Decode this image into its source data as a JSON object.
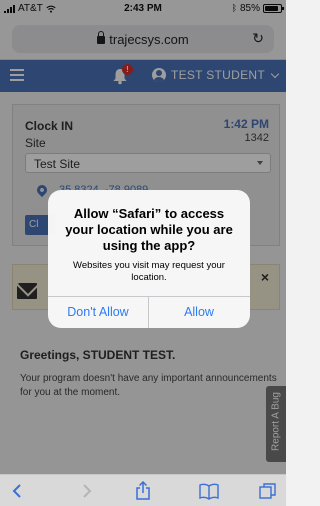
{
  "status_bar": {
    "carrier": "AT&T",
    "time": "2:43 PM",
    "battery": "85%",
    "battery_level": 0.85
  },
  "browser": {
    "url": "trajecsys.com"
  },
  "header": {
    "notification_count": "!",
    "user_name": "TEST STUDENT"
  },
  "clock_card": {
    "title": "Clock IN",
    "time": "1:42 PM",
    "sub_value": "1342",
    "site_label": "Site",
    "site_value": "Test Site",
    "coordinates": "35.8324, -78.9089",
    "button_label": "Cl"
  },
  "main": {
    "greeting": "Greetings, STUDENT TEST.",
    "announcement": "Your program doesn't have any important announcements for you at the moment.",
    "report_bug": "Report A Bug",
    "close_glyph": "×"
  },
  "alert": {
    "title": "Allow “Safari” to access your location while you are using the app?",
    "message": "Websites you visit may request your location.",
    "deny_label": "Don't Allow",
    "allow_label": "Allow"
  },
  "colors": {
    "brand": "#4a72b8",
    "ios_blue": "#2d7cf6",
    "badge_red": "#d7302c"
  },
  "toolbar": {
    "icons": [
      "back-icon",
      "forward-icon",
      "share-icon",
      "bookmarks-icon",
      "tabs-icon"
    ]
  }
}
